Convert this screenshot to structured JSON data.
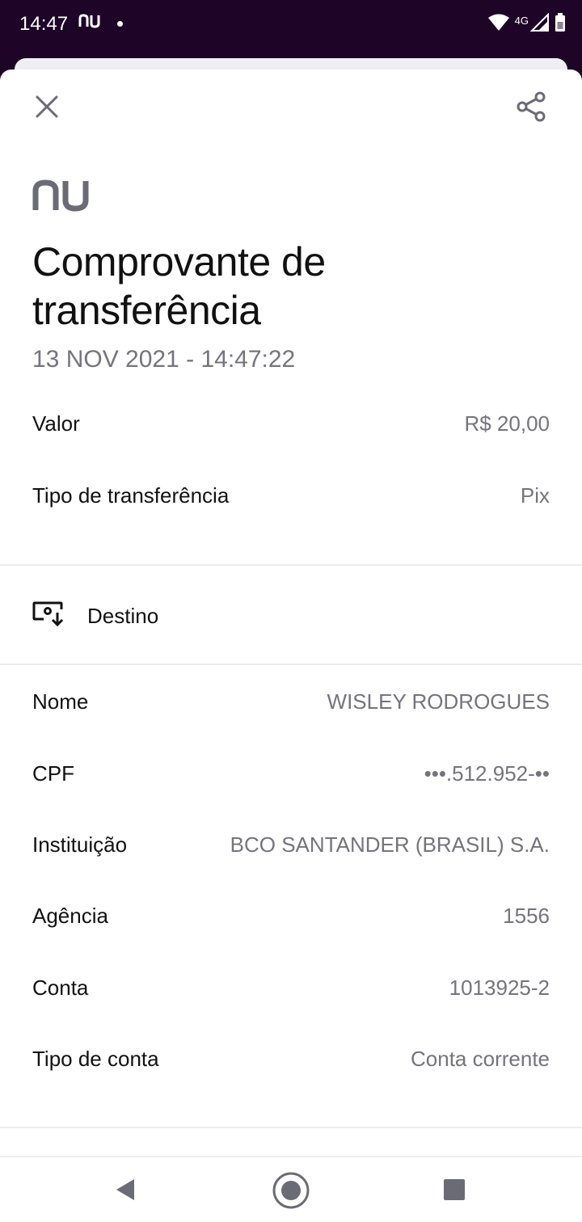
{
  "status_bar": {
    "time": "14:47",
    "app_badge": "nu",
    "network": "4G",
    "icons": [
      "wifi-icon",
      "signal-icon",
      "battery-icon"
    ]
  },
  "header": {
    "close_icon": "close-icon",
    "share_icon": "share-icon",
    "logo_text": "nu"
  },
  "receipt": {
    "title_line1": "Comprovante de",
    "title_line2": "transferência",
    "date": "13 NOV 2021 - 14:47:22",
    "summary": [
      {
        "label": "Valor",
        "value": "R$ 20,00"
      },
      {
        "label": "Tipo de transferência",
        "value": "Pix"
      }
    ]
  },
  "destination": {
    "section_label": "Destino",
    "section_icon": "destination-icon",
    "fields": [
      {
        "label": "Nome",
        "value": "WISLEY RODROGUES"
      },
      {
        "label": "CPF",
        "value": "•••.512.952-••"
      },
      {
        "label": "Instituição",
        "value": "BCO SANTANDER (BRASIL) S.A."
      },
      {
        "label": "Agência",
        "value": "1556"
      },
      {
        "label": "Conta",
        "value": "1013925-2"
      },
      {
        "label": "Tipo de conta",
        "value": "Conta corrente"
      }
    ]
  },
  "colors": {
    "status_bar_bg": "#1e0528",
    "text_primary": "#111111",
    "text_secondary": "#74747c",
    "logo": "#6b6b76"
  }
}
